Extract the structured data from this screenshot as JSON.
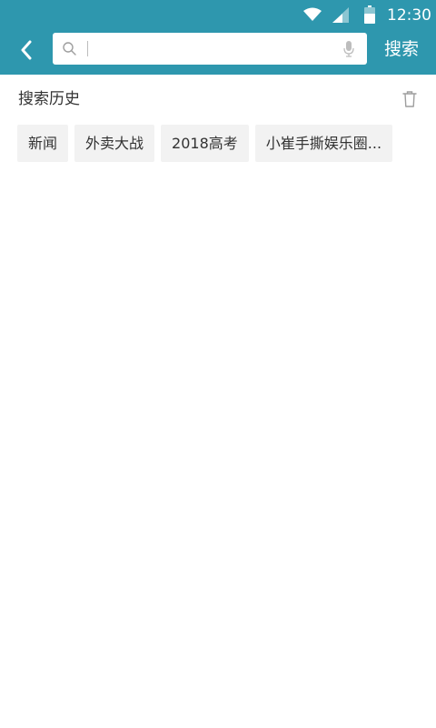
{
  "status_bar": {
    "time": "12:30",
    "icons": [
      "wifi-icon",
      "signal-icon",
      "battery-icon"
    ]
  },
  "header": {
    "search": {
      "value": "",
      "placeholder": ""
    },
    "search_button_label": "搜索"
  },
  "history": {
    "title": "搜索历史",
    "items": [
      {
        "label": "新闻"
      },
      {
        "label": "外卖大战"
      },
      {
        "label": "2018高考"
      },
      {
        "label": "小崔手撕娱乐圈..."
      }
    ]
  },
  "colors": {
    "accent": "#2e97ae",
    "chip_background": "#f2f2f2",
    "text": "#333333"
  }
}
